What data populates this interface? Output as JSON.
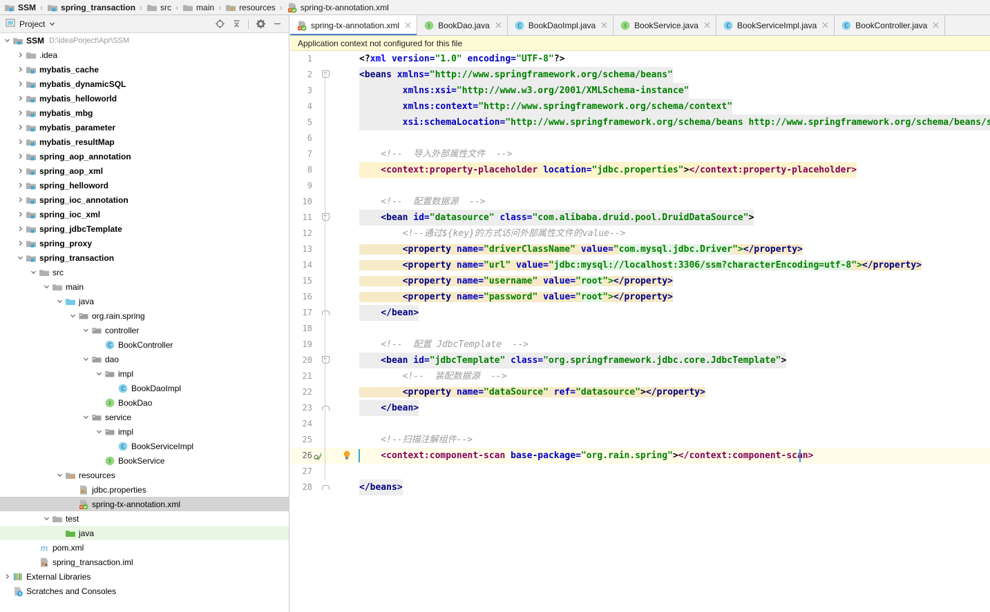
{
  "breadcrumb": {
    "items": [
      {
        "label": "SSM",
        "icon": "module-icon",
        "bold": true
      },
      {
        "label": "spring_transaction",
        "icon": "module-icon",
        "bold": true
      },
      {
        "label": "src",
        "icon": "folder-icon",
        "bold": false
      },
      {
        "label": "main",
        "icon": "folder-icon",
        "bold": false
      },
      {
        "label": "resources",
        "icon": "resource-folder-icon",
        "bold": false
      },
      {
        "label": "spring-tx-annotation.xml",
        "icon": "spring-xml-icon",
        "bold": false
      }
    ],
    "separator": "›"
  },
  "sidebar": {
    "title": "Project",
    "dropdown_icon": "chevron-down-icon",
    "tools": [
      {
        "name": "locate-icon"
      },
      {
        "name": "collapse-all-icon"
      },
      {
        "name": "settings-gear-icon"
      },
      {
        "name": "minimize-icon"
      }
    ],
    "tree": [
      {
        "label": "SSM",
        "path": "D:\\ideaPorject\\Apr\\SSM",
        "indent": 0,
        "arrow": "down",
        "icon": "module-icon",
        "bold": true
      },
      {
        "label": ".idea",
        "indent": 1,
        "arrow": "right",
        "icon": "folder-icon",
        "bold": false
      },
      {
        "label": "mybatis_cache",
        "indent": 1,
        "arrow": "right",
        "icon": "module-icon",
        "bold": true
      },
      {
        "label": "mybatis_dynamicSQL",
        "indent": 1,
        "arrow": "right",
        "icon": "module-icon",
        "bold": true
      },
      {
        "label": "mybatis_helloworld",
        "indent": 1,
        "arrow": "right",
        "icon": "module-icon",
        "bold": true
      },
      {
        "label": "mybatis_mbg",
        "indent": 1,
        "arrow": "right",
        "icon": "module-icon",
        "bold": true
      },
      {
        "label": "mybatis_parameter",
        "indent": 1,
        "arrow": "right",
        "icon": "module-icon",
        "bold": true
      },
      {
        "label": "mybatis_resultMap",
        "indent": 1,
        "arrow": "right",
        "icon": "module-icon",
        "bold": true
      },
      {
        "label": "spring_aop_annotation",
        "indent": 1,
        "arrow": "right",
        "icon": "module-icon",
        "bold": true
      },
      {
        "label": "spring_aop_xml",
        "indent": 1,
        "arrow": "right",
        "icon": "module-icon",
        "bold": true
      },
      {
        "label": "spring_helloword",
        "indent": 1,
        "arrow": "right",
        "icon": "module-icon",
        "bold": true
      },
      {
        "label": "spring_ioc_annotation",
        "indent": 1,
        "arrow": "right",
        "icon": "module-icon",
        "bold": true
      },
      {
        "label": "spring_ioc_xml",
        "indent": 1,
        "arrow": "right",
        "icon": "module-icon",
        "bold": true
      },
      {
        "label": "spring_jdbcTemplate",
        "indent": 1,
        "arrow": "right",
        "icon": "module-icon",
        "bold": true
      },
      {
        "label": "spring_proxy",
        "indent": 1,
        "arrow": "right",
        "icon": "module-icon",
        "bold": true
      },
      {
        "label": "spring_transaction",
        "indent": 1,
        "arrow": "down",
        "icon": "module-icon",
        "bold": true
      },
      {
        "label": "src",
        "indent": 2,
        "arrow": "down",
        "icon": "folder-icon",
        "bold": false
      },
      {
        "label": "main",
        "indent": 3,
        "arrow": "down",
        "icon": "folder-icon",
        "bold": false
      },
      {
        "label": "java",
        "indent": 4,
        "arrow": "down",
        "icon": "source-folder-icon",
        "bold": false
      },
      {
        "label": "org.rain.spring",
        "indent": 5,
        "arrow": "down",
        "icon": "package-icon",
        "bold": false
      },
      {
        "label": "controller",
        "indent": 6,
        "arrow": "down",
        "icon": "package-icon",
        "bold": false
      },
      {
        "label": "BookController",
        "indent": 7,
        "arrow": "none",
        "icon": "class-icon",
        "bold": false
      },
      {
        "label": "dao",
        "indent": 6,
        "arrow": "down",
        "icon": "package-icon",
        "bold": false
      },
      {
        "label": "impl",
        "indent": 7,
        "arrow": "down",
        "icon": "package-icon",
        "bold": false
      },
      {
        "label": "BookDaoImpl",
        "indent": 8,
        "arrow": "none",
        "icon": "class-icon",
        "bold": false
      },
      {
        "label": "BookDao",
        "indent": 7,
        "arrow": "none",
        "icon": "interface-icon",
        "bold": false
      },
      {
        "label": "service",
        "indent": 6,
        "arrow": "down",
        "icon": "package-icon",
        "bold": false
      },
      {
        "label": "impl",
        "indent": 7,
        "arrow": "down",
        "icon": "package-icon",
        "bold": false
      },
      {
        "label": "BookServiceImpl",
        "indent": 8,
        "arrow": "none",
        "icon": "class-icon",
        "bold": false
      },
      {
        "label": "BookService",
        "indent": 7,
        "arrow": "none",
        "icon": "interface-icon",
        "bold": false
      },
      {
        "label": "resources",
        "indent": 4,
        "arrow": "down",
        "icon": "resource-folder-icon",
        "bold": false
      },
      {
        "label": "jdbc.properties",
        "indent": 5,
        "arrow": "none",
        "icon": "properties-icon",
        "bold": false
      },
      {
        "label": "spring-tx-annotation.xml",
        "indent": 5,
        "arrow": "none",
        "icon": "spring-xml-icon",
        "bold": false,
        "selected": true
      },
      {
        "label": "test",
        "indent": 3,
        "arrow": "down",
        "icon": "folder-icon",
        "bold": false
      },
      {
        "label": "java",
        "indent": 4,
        "arrow": "none",
        "icon": "test-source-folder-icon",
        "bold": false,
        "green": true
      },
      {
        "label": "pom.xml",
        "indent": 2,
        "arrow": "none",
        "icon": "maven-icon",
        "bold": false
      },
      {
        "label": "spring_transaction.iml",
        "indent": 2,
        "arrow": "none",
        "icon": "iml-icon",
        "bold": false
      },
      {
        "label": "External Libraries",
        "indent": 0,
        "arrow": "right",
        "icon": "libraries-icon",
        "bold": false
      },
      {
        "label": "Scratches and Consoles",
        "indent": 0,
        "arrow": "none",
        "icon": "scratches-icon",
        "bold": false
      }
    ]
  },
  "editor": {
    "tabs": [
      {
        "label": "spring-tx-annotation.xml",
        "icon": "spring-xml-icon",
        "active": true
      },
      {
        "label": "BookDao.java",
        "icon": "interface-icon",
        "active": false
      },
      {
        "label": "BookDaoImpl.java",
        "icon": "class-icon",
        "active": false
      },
      {
        "label": "BookService.java",
        "icon": "interface-icon",
        "active": false
      },
      {
        "label": "BookServiceImpl.java",
        "icon": "class-icon",
        "active": false
      },
      {
        "label": "BookController.java",
        "icon": "class-icon",
        "active": false
      }
    ],
    "notice": "Application context not configured for this file",
    "caret_line": 26,
    "gutter_icons": {
      "bean_marker": "spring-bean-gutter-icon",
      "intention": "intention-bulb-icon"
    },
    "lines": [
      {
        "num": 1,
        "indent": 0,
        "tokens": [
          {
            "t": "<?",
            "c": "t-plain"
          },
          {
            "t": "xml",
            "c": "t-pi"
          },
          {
            "t": " version=",
            "c": "t-attr"
          },
          {
            "t": "\"1.0\"",
            "c": "t-val"
          },
          {
            "t": " encoding=",
            "c": "t-attr"
          },
          {
            "t": "\"UTF-8\"",
            "c": "t-val"
          },
          {
            "t": "?>",
            "c": "t-plain"
          }
        ]
      },
      {
        "num": 2,
        "indent": 0,
        "hl": "gray",
        "fold": "open",
        "tokens": [
          {
            "t": "<beans",
            "c": "t-tag"
          },
          {
            "t": " xmlns=",
            "c": "t-attr"
          },
          {
            "t": "\"http://www.springframework.org/schema/beans\"",
            "c": "t-val"
          }
        ]
      },
      {
        "num": 3,
        "indent": 0,
        "hl": "gray",
        "tokens": [
          {
            "t": "        xmlns:xsi=",
            "c": "t-attr"
          },
          {
            "t": "\"http://www.w3.org/2001/XMLSchema-instance\"",
            "c": "t-val"
          }
        ]
      },
      {
        "num": 4,
        "indent": 0,
        "hl": "gray",
        "tokens": [
          {
            "t": "        xmlns:context=",
            "c": "t-attr"
          },
          {
            "t": "\"http://www.springframework.org/schema/context\"",
            "c": "t-val"
          }
        ]
      },
      {
        "num": 5,
        "indent": 0,
        "hl": "gray",
        "tokens": [
          {
            "t": "        xsi:schemaLocation=",
            "c": "t-attr"
          },
          {
            "t": "\"http://www.springframework.org/schema/beans http://www.springframework.org/schema/beans/spr",
            "c": "t-val"
          }
        ]
      },
      {
        "num": 6,
        "indent": 0,
        "tokens": []
      },
      {
        "num": 7,
        "indent": 0,
        "tokens": [
          {
            "t": "    <!--  导入外部属性文件  -->",
            "c": "t-cmt"
          }
        ]
      },
      {
        "num": 8,
        "indent": 0,
        "hl": "yellow2",
        "tokens": [
          {
            "t": "    <context:property-placeholder",
            "c": "t-ctx"
          },
          {
            "t": " location=",
            "c": "t-attr"
          },
          {
            "t": "\"jdbc.properties\"",
            "c": "t-val"
          },
          {
            "t": ">",
            "c": "t-plain"
          },
          {
            "t": "</context:property-placeholder>",
            "c": "t-ctx"
          }
        ]
      },
      {
        "num": 9,
        "indent": 0,
        "tokens": []
      },
      {
        "num": 10,
        "indent": 0,
        "tokens": [
          {
            "t": "    <!--  配置数据源  -->",
            "c": "t-cmt"
          }
        ]
      },
      {
        "num": 11,
        "indent": 0,
        "hl": "gray",
        "fold": "open",
        "tokens": [
          {
            "t": "    <bean",
            "c": "t-tag"
          },
          {
            "t": " id=",
            "c": "t-attr"
          },
          {
            "t": "\"datasource\"",
            "c": "t-val"
          },
          {
            "t": " class=",
            "c": "t-attr"
          },
          {
            "t": "\"com.alibaba.druid.pool.DruidDataSource\"",
            "c": "t-val"
          },
          {
            "t": ">",
            "c": "t-plain"
          }
        ]
      },
      {
        "num": 12,
        "indent": 0,
        "tokens": [
          {
            "t": "        <!--通过${key}的方式访问外部属性文件的value-->",
            "c": "t-cmt"
          }
        ]
      },
      {
        "num": 13,
        "indent": 0,
        "tokens": [
          {
            "t": "        <property",
            "c": "t-tag",
            "hl": "yellow"
          },
          {
            "t": " name=",
            "c": "t-attr",
            "hl": "yellow"
          },
          {
            "t": "\"driverClassName\"",
            "c": "t-val",
            "hl": "yellow"
          },
          {
            "t": " value=",
            "c": "t-attr",
            "hl": "yellow"
          },
          {
            "t": "\"",
            "c": "t-val",
            "hl": "yellow"
          },
          {
            "t": "com.mysql.jdbc.Driver",
            "c": "t-val",
            "hl": "mint"
          },
          {
            "t": "\">",
            "c": "t-val",
            "hl": "yellow"
          },
          {
            "t": "</property>",
            "c": "t-tag",
            "hl": "yellow"
          }
        ]
      },
      {
        "num": 14,
        "indent": 0,
        "tokens": [
          {
            "t": "        <property",
            "c": "t-tag",
            "hl": "yellow"
          },
          {
            "t": " name=",
            "c": "t-attr",
            "hl": "yellow"
          },
          {
            "t": "\"url\"",
            "c": "t-val",
            "hl": "yellow"
          },
          {
            "t": " value=",
            "c": "t-attr",
            "hl": "yellow"
          },
          {
            "t": "\"",
            "c": "t-val",
            "hl": "yellow"
          },
          {
            "t": "jdbc:mysql://localhost:3306/ssm?characterEncoding=utf-8",
            "c": "t-val",
            "hl": "mint"
          },
          {
            "t": "\">",
            "c": "t-val",
            "hl": "yellow"
          },
          {
            "t": "</property>",
            "c": "t-tag",
            "hl": "yellow"
          }
        ]
      },
      {
        "num": 15,
        "indent": 0,
        "tokens": [
          {
            "t": "        <property",
            "c": "t-tag",
            "hl": "yellow"
          },
          {
            "t": " name=",
            "c": "t-attr",
            "hl": "yellow"
          },
          {
            "t": "\"username\"",
            "c": "t-val",
            "hl": "yellow"
          },
          {
            "t": " value=",
            "c": "t-attr",
            "hl": "yellow"
          },
          {
            "t": "\"",
            "c": "t-val",
            "hl": "yellow"
          },
          {
            "t": "root",
            "c": "t-val",
            "hl": "mint"
          },
          {
            "t": "\">",
            "c": "t-val",
            "hl": "yellow"
          },
          {
            "t": "</property>",
            "c": "t-tag",
            "hl": "yellow"
          }
        ]
      },
      {
        "num": 16,
        "indent": 0,
        "tokens": [
          {
            "t": "        <property",
            "c": "t-tag",
            "hl": "yellow"
          },
          {
            "t": " name=",
            "c": "t-attr",
            "hl": "yellow"
          },
          {
            "t": "\"password\"",
            "c": "t-val",
            "hl": "yellow"
          },
          {
            "t": " value=",
            "c": "t-attr",
            "hl": "yellow"
          },
          {
            "t": "\"",
            "c": "t-val",
            "hl": "yellow"
          },
          {
            "t": "root",
            "c": "t-val",
            "hl": "mint"
          },
          {
            "t": "\">",
            "c": "t-val",
            "hl": "yellow"
          },
          {
            "t": "</property>",
            "c": "t-tag",
            "hl": "yellow"
          }
        ]
      },
      {
        "num": 17,
        "indent": 0,
        "hl": "gray",
        "fold": "close",
        "tokens": [
          {
            "t": "    </bean>",
            "c": "t-tag"
          }
        ]
      },
      {
        "num": 18,
        "indent": 0,
        "tokens": []
      },
      {
        "num": 19,
        "indent": 0,
        "tokens": [
          {
            "t": "    <!--  配置 JdbcTemplate  -->",
            "c": "t-cmt"
          }
        ]
      },
      {
        "num": 20,
        "indent": 0,
        "hl": "gray",
        "fold": "open",
        "tokens": [
          {
            "t": "    <bean",
            "c": "t-tag"
          },
          {
            "t": " id=",
            "c": "t-attr"
          },
          {
            "t": "\"jdbcTemplate\"",
            "c": "t-val"
          },
          {
            "t": " class=",
            "c": "t-attr"
          },
          {
            "t": "\"org.springframework.jdbc.core.JdbcTemplate\"",
            "c": "t-val"
          },
          {
            "t": ">",
            "c": "t-plain"
          }
        ]
      },
      {
        "num": 21,
        "indent": 0,
        "tokens": [
          {
            "t": "        <!--  装配数据源  -->",
            "c": "t-cmt"
          }
        ]
      },
      {
        "num": 22,
        "indent": 0,
        "tokens": [
          {
            "t": "        <property",
            "c": "t-tag",
            "hl": "yellow"
          },
          {
            "t": " name=",
            "c": "t-attr",
            "hl": "yellow"
          },
          {
            "t": "\"dataSource\"",
            "c": "t-val",
            "hl": "yellow"
          },
          {
            "t": " ref=",
            "c": "t-attr",
            "hl": "yellow"
          },
          {
            "t": "\"datasource\"",
            "c": "t-val",
            "hl": "yellow"
          },
          {
            "t": ">",
            "c": "t-plain",
            "hl": "yellow"
          },
          {
            "t": "</property>",
            "c": "t-tag",
            "hl": "yellow"
          }
        ]
      },
      {
        "num": 23,
        "indent": 0,
        "hl": "gray",
        "fold": "close",
        "tokens": [
          {
            "t": "    </bean>",
            "c": "t-tag"
          }
        ]
      },
      {
        "num": 24,
        "indent": 0,
        "tokens": []
      },
      {
        "num": 25,
        "indent": 0,
        "tokens": [
          {
            "t": "    <!--扫描注解组件-->",
            "c": "t-cmt"
          }
        ]
      },
      {
        "num": 26,
        "indent": 0,
        "caret": true,
        "tokens": [
          {
            "t": "    <context:component-scan",
            "c": "t-ctx"
          },
          {
            "t": " base-package=",
            "c": "t-attr"
          },
          {
            "t": "\"org.rain.spring\"",
            "c": "t-val"
          },
          {
            "t": ">",
            "c": "t-plain"
          },
          {
            "t": "</context:component-scan>",
            "c": "t-ctx"
          }
        ]
      },
      {
        "num": 27,
        "indent": 0,
        "tokens": []
      },
      {
        "num": 28,
        "indent": 0,
        "hl": "gray",
        "fold": "close",
        "tokens": [
          {
            "t": "</beans>",
            "c": "t-tag"
          }
        ]
      }
    ]
  }
}
